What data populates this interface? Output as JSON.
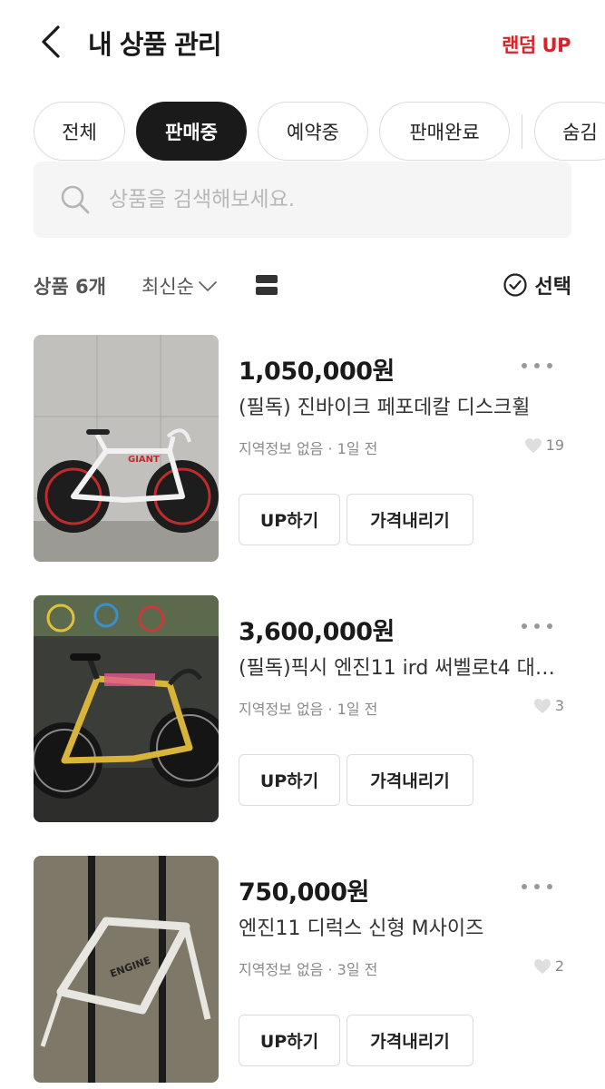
{
  "header": {
    "title": "내 상품 관리",
    "random_up": "랜덤 UP"
  },
  "tabs": [
    {
      "label": "전체",
      "active": false
    },
    {
      "label": "판매중",
      "active": true
    },
    {
      "label": "예약중",
      "active": false
    },
    {
      "label": "판매완료",
      "active": false
    },
    {
      "label": "숨김",
      "active": false
    }
  ],
  "search": {
    "placeholder": "상품을 검색해보세요."
  },
  "toolbar": {
    "count_prefix": "상품",
    "count": "6개",
    "sort_label": "최신순",
    "select_label": "선택"
  },
  "products": [
    {
      "price": "1,050,000원",
      "title": "(필독) 진바이크 페포데칼 디스크휠",
      "meta": "지역정보 없음 · 1일 전",
      "likes": "19",
      "up_label": "UP하기",
      "price_down_label": "가격내리기"
    },
    {
      "price": "3,600,000원",
      "title": "(필독)픽시 엔진11 ird 써벨로t4 대…",
      "meta": "지역정보 없음 · 1일 전",
      "likes": "3",
      "up_label": "UP하기",
      "price_down_label": "가격내리기"
    },
    {
      "price": "750,000원",
      "title": "엔진11 디럭스 신형 M사이즈",
      "meta": "지역정보 없음 · 3일 전",
      "likes": "2",
      "up_label": "UP하기",
      "price_down_label": "가격내리기"
    }
  ],
  "colors": {
    "accent": "#d8232a",
    "active_tab": "#1a1a1a"
  }
}
